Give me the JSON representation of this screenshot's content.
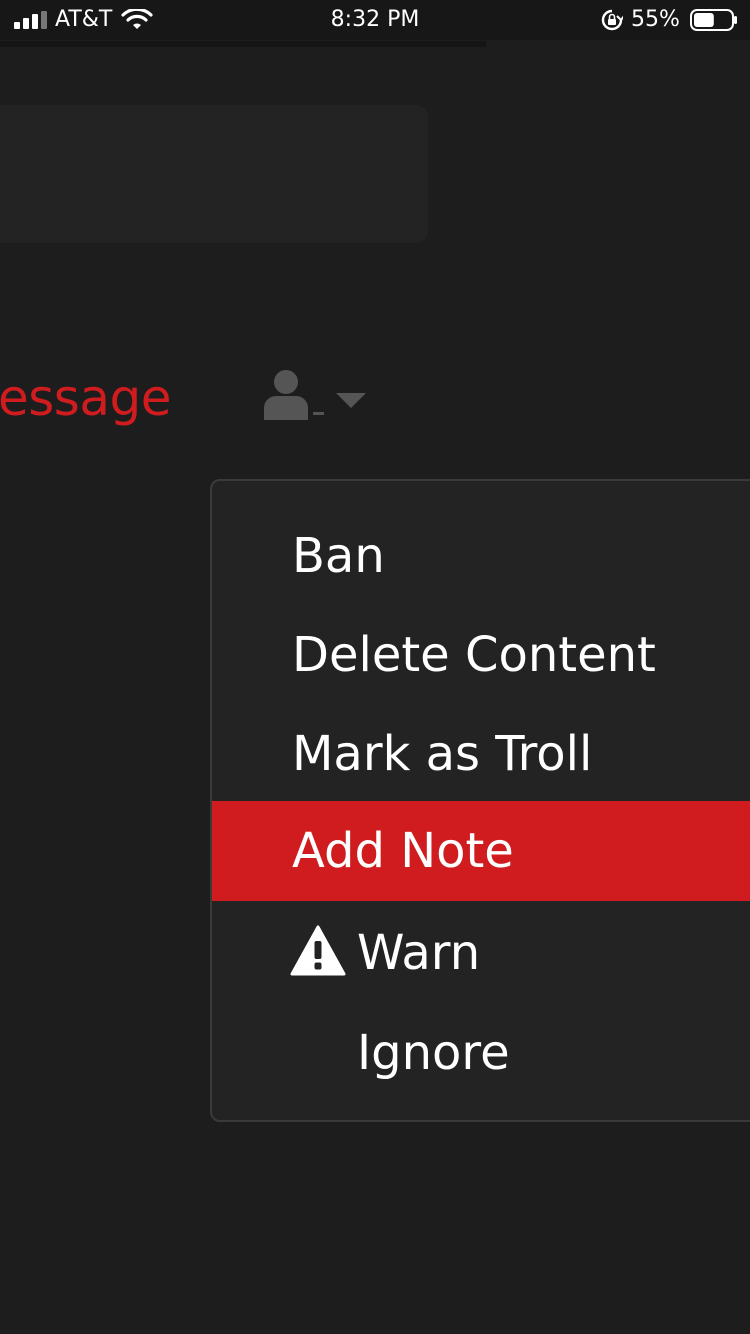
{
  "status_bar": {
    "carrier": "AT&T",
    "time": "8:32 PM",
    "battery_percent": "55%",
    "battery_level": 0.55
  },
  "page": {
    "message_link": "essage"
  },
  "menu": {
    "items": [
      {
        "label": "Ban"
      },
      {
        "label": "Delete Content"
      },
      {
        "label": "Mark as Troll"
      },
      {
        "label": "Add Note",
        "highlighted": true
      },
      {
        "label": "Warn",
        "icon": "warning-icon"
      },
      {
        "label": "Ignore"
      }
    ]
  },
  "colors": {
    "background": "#1d1d1d",
    "panel": "#232323",
    "accent": "#d01c1f",
    "icon_gray": "#555555"
  }
}
